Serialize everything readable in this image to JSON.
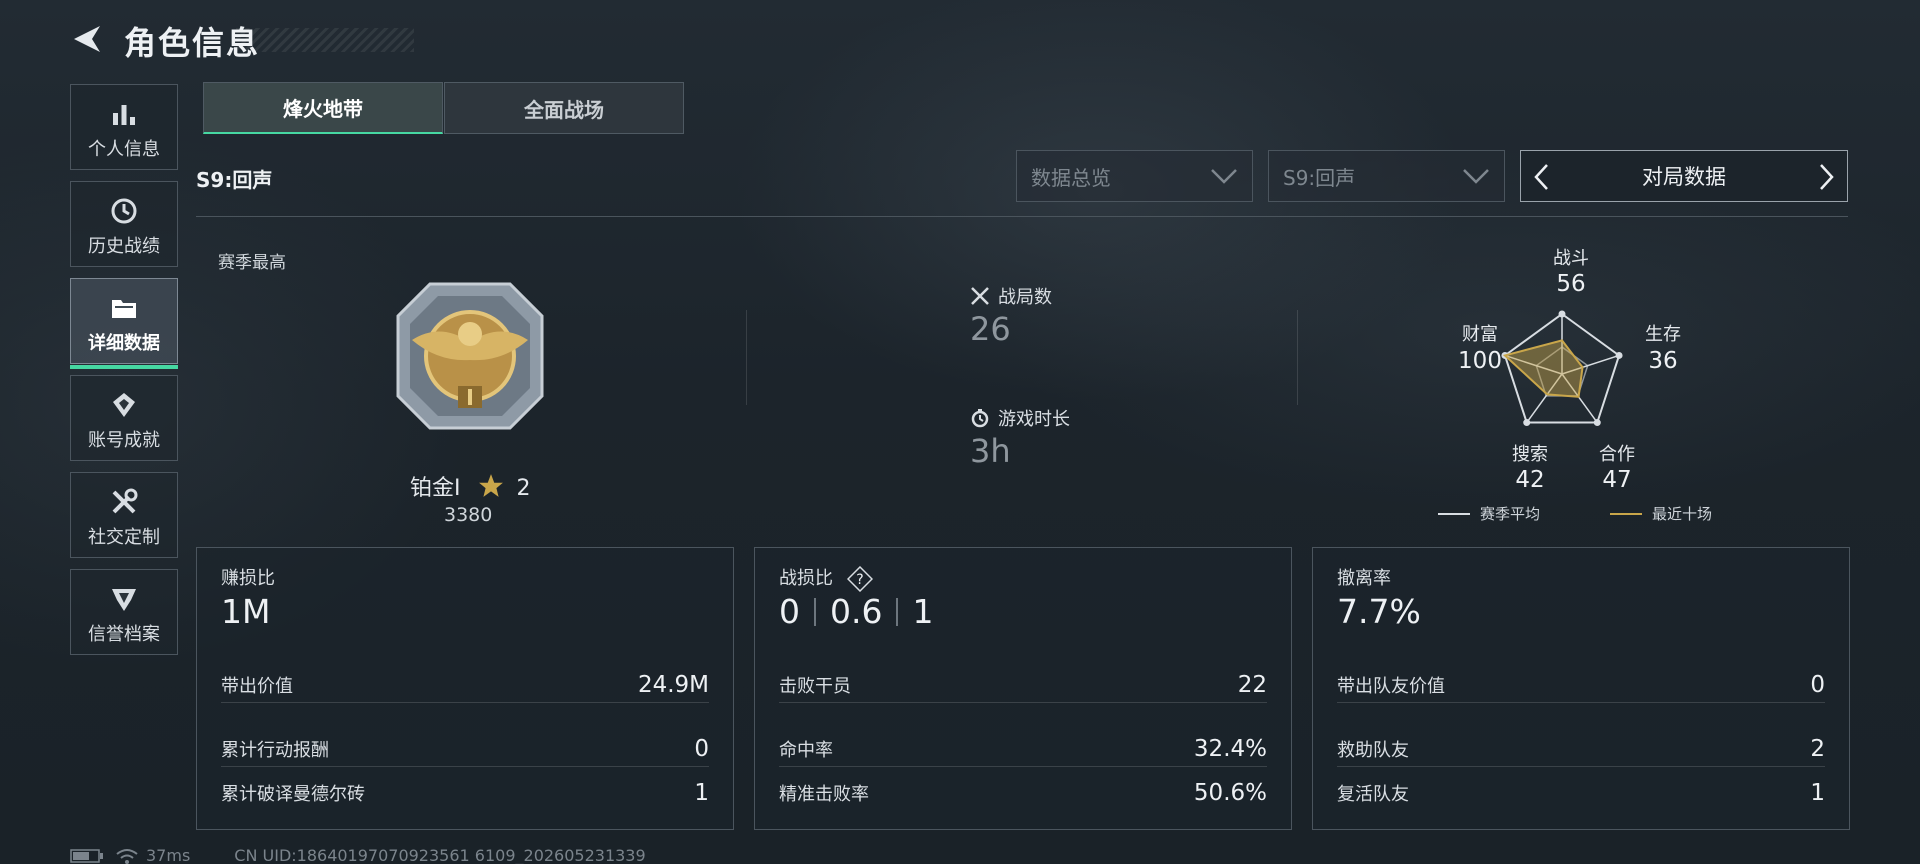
{
  "header": {
    "title": "角色信息"
  },
  "sidebar": {
    "items": [
      {
        "label": "个人信息",
        "icon": "bar-chart-icon"
      },
      {
        "label": "历史战绩",
        "icon": "clock-icon"
      },
      {
        "label": "详细数据",
        "icon": "folder-icon",
        "active": true
      },
      {
        "label": "账号成就",
        "icon": "achievement-icon"
      },
      {
        "label": "社交定制",
        "icon": "tools-icon"
      },
      {
        "label": "信誉档案",
        "icon": "reputation-icon"
      }
    ]
  },
  "tabs": [
    {
      "label": "烽火地带",
      "active": true
    },
    {
      "label": "全面战场",
      "active": false
    }
  ],
  "filters": {
    "season_label": "S9:回声",
    "dropdown_overview": "数据总览",
    "dropdown_season": "S9:回声",
    "mode_switch": "对局数据"
  },
  "season_best": {
    "label": "赛季最高",
    "rank": "铂金Ⅰ",
    "stars": "2",
    "score": "3380"
  },
  "middle_stats": {
    "matches_label": "战局数",
    "matches_value": "26",
    "playtime_label": "游戏时长",
    "playtime_value": "3h"
  },
  "radar": {
    "axes": [
      {
        "label": "战斗",
        "value": "56"
      },
      {
        "label": "生存",
        "value": "36"
      },
      {
        "label": "合作",
        "value": "47"
      },
      {
        "label": "搜索",
        "value": "42"
      },
      {
        "label": "财富",
        "value": "100"
      }
    ],
    "legend_season_avg": "赛季平均",
    "legend_recent": "最近十场",
    "color_recent": "#c9a64a",
    "color_avg": "#d8dde2"
  },
  "panels": {
    "profit": {
      "label": "赚损比",
      "value": "1M",
      "rows": [
        {
          "label": "带出价值",
          "value": "24.9M"
        },
        {
          "label": "累计行动报酬",
          "value": "0"
        },
        {
          "label": "累计破译曼德尔砖",
          "value": "1"
        }
      ]
    },
    "kd": {
      "label": "战损比",
      "ratio": [
        "0",
        "0.6",
        "1"
      ],
      "rows": [
        {
          "label": "击败干员",
          "value": "22"
        },
        {
          "label": "命中率",
          "value": "32.4%"
        },
        {
          "label": "精准击败率",
          "value": "50.6%"
        }
      ]
    },
    "extract": {
      "label": "撤离率",
      "value": "7.7%",
      "rows": [
        {
          "label": "带出队友价值",
          "value": "0"
        },
        {
          "label": "救助队友",
          "value": "2"
        },
        {
          "label": "复活队友",
          "value": "1"
        }
      ]
    }
  },
  "footer": {
    "ping": "37ms",
    "uid": "CN UID:18640197070923561 6109_202605231339"
  }
}
